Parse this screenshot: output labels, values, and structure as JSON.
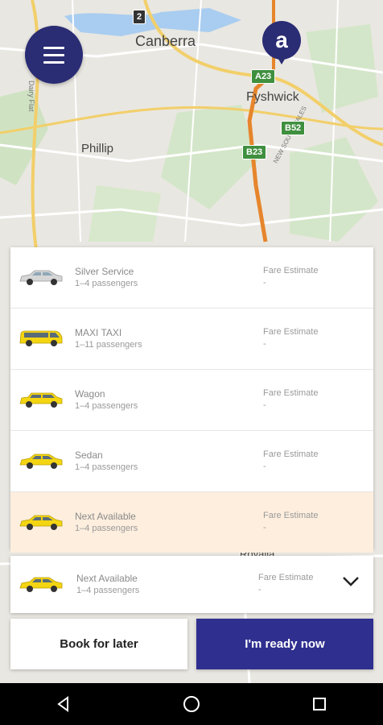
{
  "map": {
    "labels": {
      "canberra": "Canberra",
      "fyshwick": "Fyshwick",
      "phillip": "Phillip",
      "nsw": "NEW SOUTH WALES",
      "dairy": "Dairy Flat",
      "bottom": "Royalla"
    },
    "shields": {
      "a23": "A23",
      "b52": "B52",
      "b23": "B23",
      "r2": "2"
    },
    "pin_letter": "a"
  },
  "header": {
    "menu_icon": "hamburger-menu-icon"
  },
  "vehicles": [
    {
      "name": "Silver Service",
      "passengers": "1–4 passengers",
      "fare_label": "Fare Estimate",
      "fare_value": "-",
      "color": "#d8d8d8",
      "type": "sedan"
    },
    {
      "name": "MAXI TAXI",
      "passengers": "1–11 passengers",
      "fare_label": "Fare Estimate",
      "fare_value": "-",
      "color": "#f4d512",
      "type": "van"
    },
    {
      "name": "Wagon",
      "passengers": "1–4 passengers",
      "fare_label": "Fare Estimate",
      "fare_value": "-",
      "color": "#f4d512",
      "type": "wagon"
    },
    {
      "name": "Sedan",
      "passengers": "1–4 passengers",
      "fare_label": "Fare Estimate",
      "fare_value": "-",
      "color": "#f4d512",
      "type": "sedan"
    },
    {
      "name": "Next Available",
      "passengers": "1–4 passengers",
      "fare_label": "Fare Estimate",
      "fare_value": "-",
      "color": "#f4d512",
      "type": "sedan",
      "selected": true
    }
  ],
  "selected": {
    "name": "Next Available",
    "passengers": "1–4 passengers",
    "fare_label": "Fare Estimate",
    "fare_value": "-"
  },
  "actions": {
    "book_later": "Book for later",
    "ready_now": "I'm ready now"
  },
  "colors": {
    "brand": "#2a2c74",
    "button": "#2f2f8f",
    "selected_row": "#fdeede",
    "taxi_yellow": "#f4d512"
  }
}
